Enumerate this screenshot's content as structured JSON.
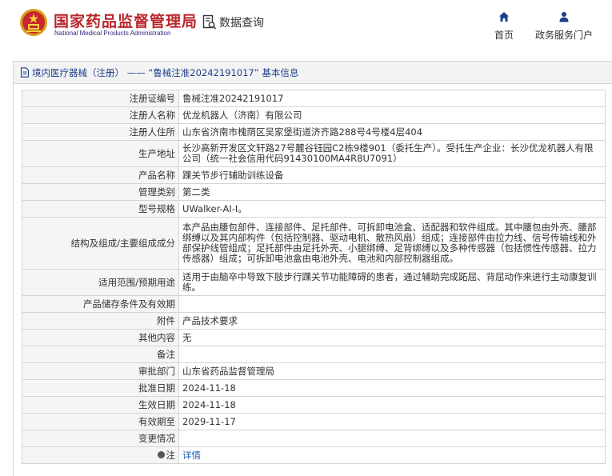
{
  "header": {
    "brand_cn": "国家药品监督管理局",
    "brand_en": "National Medical Products Administration",
    "query_label": "数据查询",
    "nav": [
      {
        "label": "首页",
        "icon": "home-icon"
      },
      {
        "label": "政务服务门户",
        "icon": "user-icon"
      }
    ],
    "brand_color": "#b8262c"
  },
  "breadcrumb": {
    "text": "境内医疗器械（注册） —— “鲁械注准20242191017” 基本信息",
    "icon": "document-icon"
  },
  "table": {
    "rows": [
      {
        "key": "注册证编号",
        "value": "鲁械注准20242191017"
      },
      {
        "key": "注册人名称",
        "value": "优龙机器人（济南）有限公司"
      },
      {
        "key": "注册人住所",
        "value": "山东省济南市槐荫区吴家堡街道济齐路288号4号楼4层404"
      },
      {
        "key": "生产地址",
        "value": "长沙高新开发区文轩路27号麓谷钰园C2栋9楼901（委托生产）。受托生产企业：长沙优龙机器人有限公司（统一社会信用代码91430100MA4R8U7091）"
      },
      {
        "key": "产品名称",
        "value": "踝关节步行辅助训练设备"
      },
      {
        "key": "管理类别",
        "value": "第二类"
      },
      {
        "key": "型号规格",
        "value": "UWalker-AI-I。"
      },
      {
        "key": "结构及组成/主要组成成分",
        "value": "本产品由腰包部件、连接部件、足托部件、可拆卸电池盒、适配器和软件组成。其中腰包由外壳、腰部绑缚以及其内部构件（包括控制器、驱动电机、散热风扇）组成；连接部件由拉力线、信号传输线和外部保护线管组成；足托部件由足托外壳、小腿绑缚、足背绑缚以及多种传感器（包括惯性传感器、拉力传感器）组成；可拆卸电池盒由电池外壳、电池和内部控制器组成。"
      },
      {
        "key": "适用范围/预期用途",
        "value": "适用于由脑卒中导致下肢步行踝关节功能障碍的患者，通过辅助完成跖屈、背屈动作来进行主动康复训练。"
      },
      {
        "key": "产品储存条件及有效期",
        "value": ""
      },
      {
        "key": "附件",
        "value": "产品技术要求"
      },
      {
        "key": "其他内容",
        "value": "无"
      },
      {
        "key": "备注",
        "value": ""
      },
      {
        "key": "审批部门",
        "value": "山东省药品监督管理局"
      },
      {
        "key": "批准日期",
        "value": "2024-11-18"
      },
      {
        "key": "生效日期",
        "value": "2024-11-18"
      },
      {
        "key": "有效期至",
        "value": "2029-11-17"
      },
      {
        "key": "变更情况",
        "value": ""
      },
      {
        "key": "注",
        "value": "详情"
      }
    ]
  }
}
